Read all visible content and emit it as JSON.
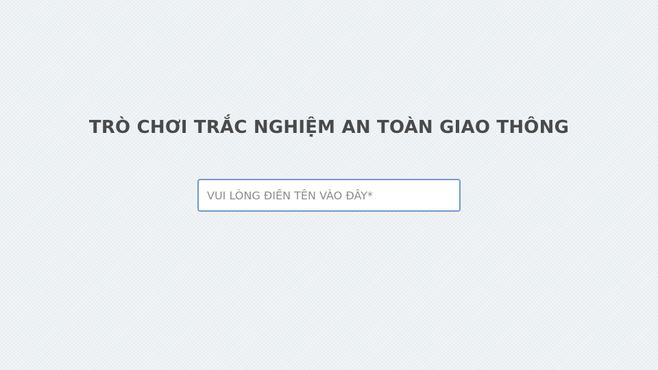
{
  "game": {
    "title": "TRÒ CHƠI TRẮC NGHIỆM AN TOÀN GIAO THÔNG"
  },
  "name_input": {
    "value": "",
    "placeholder": "VUI LÒNG ĐIỀN TÊN VÀO ĐÂY*"
  },
  "colors": {
    "background": "#eef2f4",
    "title_text": "#4a4a4a",
    "input_border": "#6f98cc",
    "placeholder_text": "#8c8c8c"
  }
}
